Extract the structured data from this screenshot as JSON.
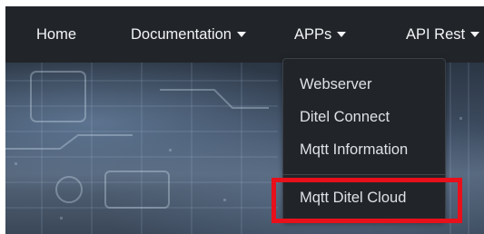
{
  "navbar": {
    "items": [
      {
        "label": "Home",
        "has_dropdown": false
      },
      {
        "label": "Documentation",
        "has_dropdown": true
      },
      {
        "label": "APPs",
        "has_dropdown": true
      },
      {
        "label": "API Rest",
        "has_dropdown": true
      }
    ]
  },
  "apps_dropdown": {
    "items": [
      {
        "label": "Webserver"
      },
      {
        "label": "Ditel Connect"
      },
      {
        "label": "Mqtt Information"
      },
      {
        "label": "Mqtt Ditel Cloud",
        "highlighted": true
      }
    ]
  },
  "colors": {
    "navbar_bg": "#212529",
    "dropdown_bg": "#212529",
    "text": "#f3f4f6",
    "highlight": "#e8101a"
  },
  "icons": {
    "caret": "caret-down-icon"
  }
}
